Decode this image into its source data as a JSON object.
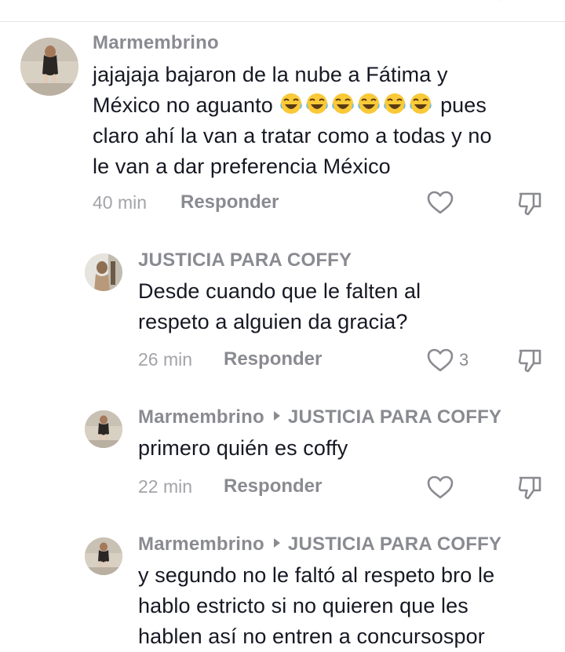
{
  "comments": [
    {
      "username": "Marmembrino",
      "text_line1": "jajajaja bajaron de la nube a Fátima y",
      "text_line2a": "México no aguanto ",
      "emoji_laugh": "😂😂😂😂😂😂",
      "text_line2b": " pues",
      "text_line3": "claro ahí la van a tratar como a todas y no",
      "text_line4": "le van a dar preferencia México",
      "time": "40 min",
      "reply_label": "Responder"
    },
    {
      "username": "JUSTICIA PARA COFFY",
      "text_line1": "Desde cuando que le falten al",
      "text_line2": "respeto a alguien da gracia?",
      "time": "26 min",
      "reply_label": "Responder",
      "likes": "3"
    },
    {
      "username": "Marmembrino",
      "reply_to": "JUSTICIA PARA COFFY",
      "text_line1": "primero quién es coffy",
      "time": "22 min",
      "reply_label": "Responder"
    },
    {
      "username": "Marmembrino",
      "reply_to": "JUSTICIA PARA COFFY",
      "text_line1": "y segundo no le faltó al respeto bro le",
      "text_line2": "hablo estricto si no quieren que les",
      "text_line3": "hablen así no entren a concursospor"
    }
  ],
  "icons": {
    "like": "heart-outline-icon",
    "dislike": "thumbs-down-icon",
    "reply_arrow": "triangle-right-icon"
  },
  "colors": {
    "text": "#161823",
    "muted": "#8a8b91",
    "timestamp": "#a3a4a8"
  }
}
